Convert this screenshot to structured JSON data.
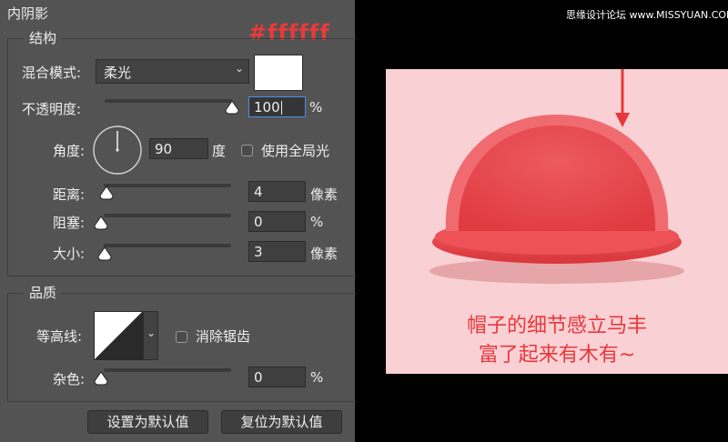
{
  "panel": {
    "title": "内阴影",
    "structure": {
      "legend": "结构",
      "blend_mode_label": "混合模式:",
      "blend_mode_value": "柔光",
      "swatch_color": "#ffffff",
      "opacity_label": "不透明度:",
      "opacity_value": "100",
      "opacity_unit": "%",
      "angle_label": "角度:",
      "angle_value": "90",
      "angle_unit": "度",
      "global_light_label": "使用全局光",
      "distance_label": "距离:",
      "distance_value": "4",
      "distance_unit": "像素",
      "choke_label": "阻塞:",
      "choke_value": "0",
      "choke_unit": "%",
      "size_label": "大小:",
      "size_value": "3",
      "size_unit": "像素"
    },
    "quality": {
      "legend": "品质",
      "contour_label": "等高线:",
      "antialias_label": "消除锯齿",
      "noise_label": "杂色:",
      "noise_value": "0",
      "noise_unit": "%"
    },
    "buttons": {
      "set_default": "设置为默认值",
      "reset_default": "复位为默认值"
    }
  },
  "annotation": {
    "hex": "#ffffff",
    "color": "#e83a3a"
  },
  "watermark": "思缘设计论坛 www.MISSYUAN.COM",
  "preview": {
    "background": "#f9d0d3",
    "caption_line1": "帽子的细节感立马丰",
    "caption_line2": "富了起来有木有~"
  }
}
